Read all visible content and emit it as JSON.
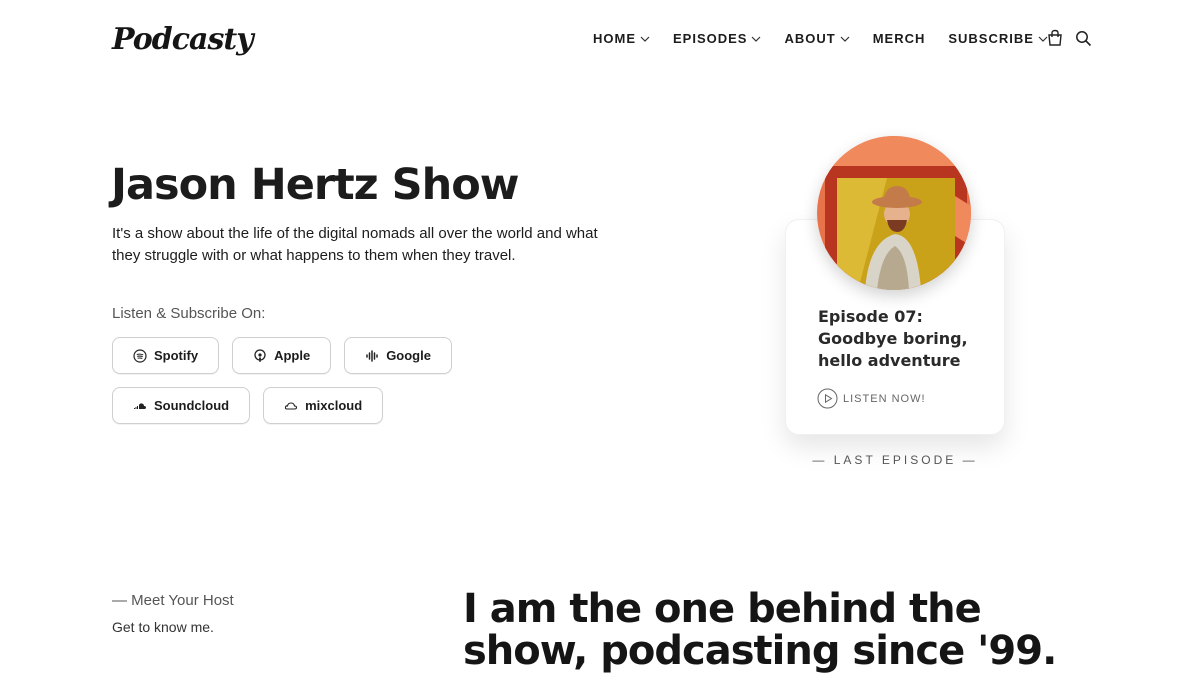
{
  "header": {
    "logo_text": "Podcasty",
    "nav": [
      {
        "label": "HOME",
        "has_dropdown": true
      },
      {
        "label": "EPISODES",
        "has_dropdown": true
      },
      {
        "label": "ABOUT",
        "has_dropdown": true
      },
      {
        "label": "MERCH",
        "has_dropdown": false
      },
      {
        "label": "SUBSCRIBE",
        "has_dropdown": true
      }
    ],
    "icons": [
      "shopping-bag-icon",
      "search-icon"
    ]
  },
  "hero": {
    "title": "Jason Hertz Show",
    "description": "It's a show about the life of the digital nomads all over the world and what they struggle with or what happens to them when they travel.",
    "listen_label": "Listen & Subscribe On:",
    "platforms": [
      {
        "label": "Spotify",
        "icon": "spotify-icon"
      },
      {
        "label": "Apple",
        "icon": "apple-podcasts-icon"
      },
      {
        "label": "Google",
        "icon": "google-podcasts-icon"
      },
      {
        "label": "Soundcloud",
        "icon": "soundcloud-icon"
      },
      {
        "label": "mixcloud",
        "icon": "mixcloud-icon"
      }
    ]
  },
  "episode": {
    "title": "Episode 07: Goodbye boring, hello adventure",
    "listen_label": "LISTEN NOW!",
    "section_label": "— LAST EPISODE —"
  },
  "host": {
    "kicker": "— Meet Your Host",
    "subtitle": "Get to know me.",
    "headline": "I am the one behind the show, podcasting since '99."
  },
  "colors": {
    "text": "#1c1c1c",
    "muted": "#555555",
    "border": "#cfcfcf",
    "cover_orange": "#e8734a",
    "cover_yellow": "#c9a21a"
  }
}
